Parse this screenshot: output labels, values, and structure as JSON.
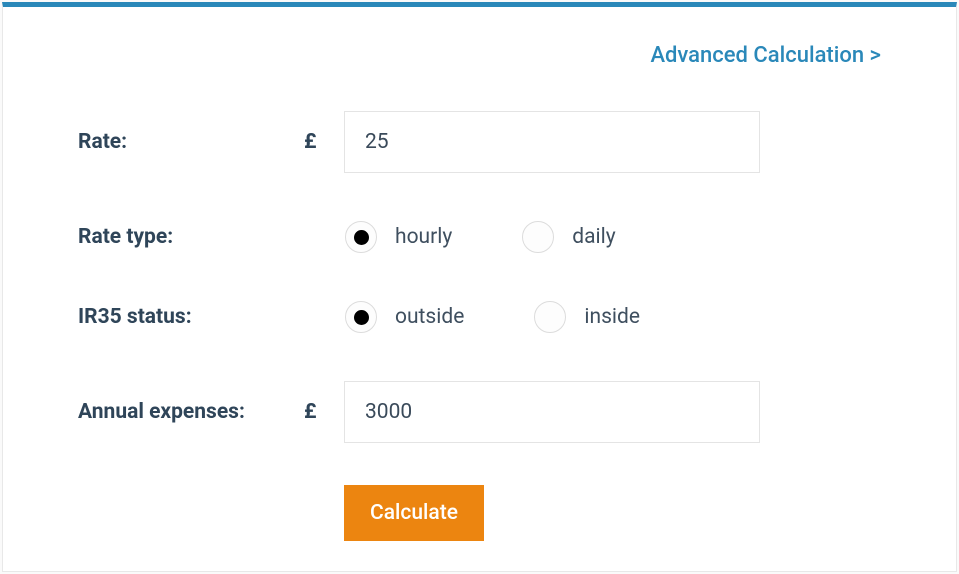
{
  "advanced_link": "Advanced Calculation >",
  "currency_symbol": "£",
  "fields": {
    "rate": {
      "label": "Rate:",
      "value": "25"
    },
    "rate_type": {
      "label": "Rate type:",
      "options": {
        "hourly": "hourly",
        "daily": "daily"
      },
      "selected": "hourly"
    },
    "ir35_status": {
      "label": "IR35 status:",
      "options": {
        "outside": "outside",
        "inside": "inside"
      },
      "selected": "outside"
    },
    "annual_expenses": {
      "label": "Annual expenses:",
      "value": "3000"
    }
  },
  "calculate_button": "Calculate"
}
